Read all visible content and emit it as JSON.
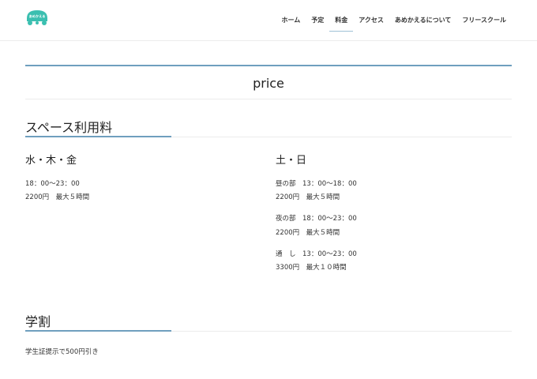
{
  "header": {
    "logo_text": "あめかえる",
    "nav": [
      {
        "label": "ホーム",
        "active": false
      },
      {
        "label": "予定",
        "active": false
      },
      {
        "label": "料金",
        "active": true
      },
      {
        "label": "アクセス",
        "active": false
      },
      {
        "label": "あめかえるについて",
        "active": false
      },
      {
        "label": "フリースクール",
        "active": false
      }
    ]
  },
  "page": {
    "title": "price"
  },
  "space_fee": {
    "heading": "スペース利用料",
    "weekday": {
      "title": "水・木・金",
      "time": "18：00〜23：00",
      "price": "2200円　最大５時間"
    },
    "weekend": {
      "title": "土・日",
      "slots": [
        {
          "time": "昼の部　13：00〜18：00",
          "price": "2200円　最大５時間"
        },
        {
          "time": "夜の部　18：00〜23：00",
          "price": "2200円　最大５時間"
        },
        {
          "time": "通　し　13：00〜23：00",
          "price": "3300円　最大１０時間"
        }
      ]
    }
  },
  "student": {
    "heading": "学割",
    "text": "学生証提示で500円引き"
  },
  "colors": {
    "accent": "#6f9fbe",
    "logo": "#3bbfb0"
  }
}
